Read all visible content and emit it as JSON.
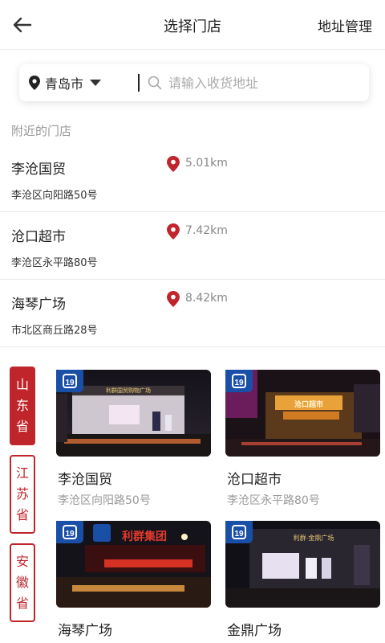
{
  "header": {
    "title": "选择门店",
    "address_manage": "地址管理"
  },
  "search": {
    "city": "青岛市",
    "placeholder": "请输入收货地址"
  },
  "nearby": {
    "label": "附近的门店",
    "stores": [
      {
        "name": "李沧国贸",
        "address": "李沧区向阳路50号",
        "distance": "5.01km"
      },
      {
        "name": "沧口超市",
        "address": "李沧区永平路80号",
        "distance": "7.42km"
      },
      {
        "name": "海琴广场",
        "address": "市北区商丘路28号",
        "distance": "8.42km"
      }
    ]
  },
  "provinces": [
    {
      "label": "山东省",
      "chars": [
        "山",
        "东",
        "省"
      ],
      "active": true
    },
    {
      "label": "江苏省",
      "chars": [
        "江",
        "苏",
        "省"
      ],
      "active": false
    },
    {
      "label": "安徽省",
      "chars": [
        "安",
        "徽",
        "省"
      ],
      "active": false
    }
  ],
  "store_cards": [
    {
      "name": "李沧国贸",
      "address": "李沧区向阳路50号",
      "sign": "利群国贸购物广场"
    },
    {
      "name": "沧口超市",
      "address": "李沧区永平路80号",
      "sign": "沧口超市"
    },
    {
      "name": "海琴广场",
      "address": "",
      "sign": "利群集团"
    },
    {
      "name": "金鼎广场",
      "address": "",
      "sign": "利群·金鼎广场"
    }
  ],
  "colors": {
    "accent": "#c0252b",
    "brand_badge": "#1a4fa8",
    "muted_text": "#999999"
  }
}
